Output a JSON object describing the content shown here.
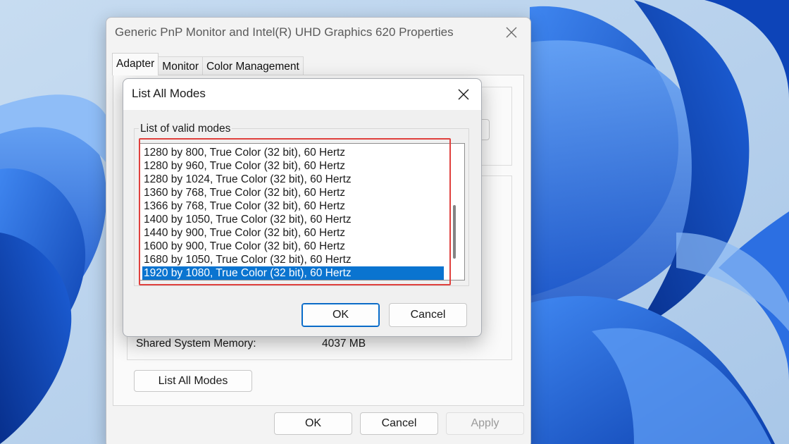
{
  "properties_window": {
    "title": "Generic PnP Monitor and Intel(R) UHD Graphics 620 Properties",
    "tabs": [
      {
        "label": "Adapter",
        "active": true
      },
      {
        "label": "Monitor",
        "active": false
      },
      {
        "label": "Color Management",
        "active": false
      }
    ],
    "shared_memory_label": "Shared System Memory:",
    "shared_memory_value": "4037 MB",
    "list_all_modes_label": "List All Modes",
    "ok_label": "OK",
    "cancel_label": "Cancel",
    "apply_label": "Apply",
    "apply_disabled": true
  },
  "modes_dialog": {
    "title": "List All Modes",
    "group_label": "List of valid modes",
    "modes": [
      "1280 by 800, True Color (32 bit), 60 Hertz",
      "1280 by 960, True Color (32 bit), 60 Hertz",
      "1280 by 1024, True Color (32 bit), 60 Hertz",
      "1360 by 768, True Color (32 bit), 60 Hertz",
      "1366 by 768, True Color (32 bit), 60 Hertz",
      "1400 by 1050, True Color (32 bit), 60 Hertz",
      "1440 by 900, True Color (32 bit), 60 Hertz",
      "1600 by 900, True Color (32 bit), 60 Hertz",
      "1680 by 1050, True Color (32 bit), 60 Hertz",
      "1920 by 1080, True Color (32 bit), 60 Hertz"
    ],
    "selected_index": 9,
    "ok_label": "OK",
    "cancel_label": "Cancel"
  },
  "colors": {
    "selection": "#0a74d0",
    "highlight_annotation": "#e0403d",
    "wallpaper_blue": "#1b5fd6"
  },
  "icons": {
    "close": "close-icon"
  }
}
